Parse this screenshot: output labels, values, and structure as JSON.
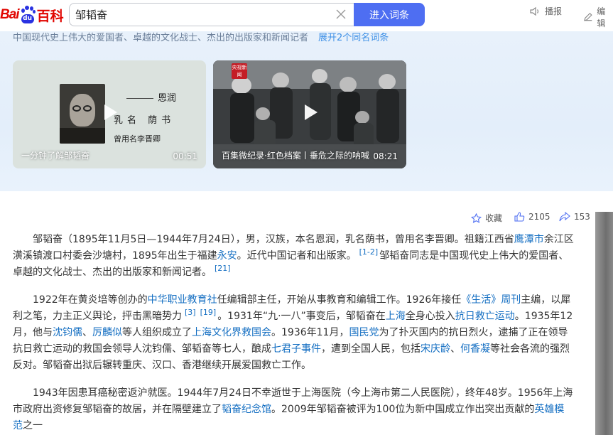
{
  "header": {
    "logo": {
      "bai": "Bai",
      "du": "du",
      "baike": "百科"
    },
    "search_value": "邹韬奋",
    "search_button": "进入词条",
    "broadcast": "播报",
    "edit": "编辑"
  },
  "banner": {
    "summary": "中国现代史上伟大的爱国者、卓越的文化战士、杰出的出版家和新闻记者",
    "more": "展开2个同名词条",
    "videos": [
      {
        "caption": "一分钟了解邹韬奋",
        "duration": "00:51",
        "poster_lines": [
          "恩润",
          "乳名 荫书",
          "曾用名李晋卿"
        ]
      },
      {
        "caption": "百集微纪录·红色档案丨垂危之际的呐喊",
        "duration": "08:21",
        "badge": "央视新闻"
      }
    ]
  },
  "stats": {
    "collect": "收藏",
    "likes": "2105",
    "shares": "153"
  },
  "article": {
    "p1": {
      "t1": "邹韬奋（1895年11月5日—1944年7月24日），男，汉族，本名恩润，乳名荫书，曾用名李晋卿。祖籍江西省",
      "l1": "鹰潭市",
      "t2": "余江区潢溪镇渡口村委会沙塘村，1895年出生于福建",
      "l2": "永安",
      "t3": "。近代中国记者和出版家。",
      "r1": "[1-2]",
      "t4": "邹韬奋同志是中国现代史上伟大的爱国者、卓越的文化战士、杰出的出版家和新闻记者。",
      "r2": "[21]"
    },
    "p2": {
      "t1": "1922年在黄炎培等创办的",
      "l1": "中华职业教育社",
      "t2": "任编辑部主任，开始从事教育和编辑工作。1926年接任",
      "l2": "《生活》周刊",
      "t3": "主编，以犀利之笔，力主正义舆论，抨击黑暗势力",
      "r1": "[3]",
      "r2": "[19]",
      "t4": "。1931年“九·一八”事变后，邹韬奋在",
      "l3": "上海",
      "t5": "全身心投入",
      "l4": "抗日救亡运动",
      "t6": "。1935年12月，他与",
      "l5": "沈钧儒",
      "t7": "、",
      "l6": "厉麟似",
      "t8": "等人组织成立了",
      "l7": "上海文化界救国会",
      "t9": "。1936年11月，",
      "l8": "国民党",
      "t10": "为了扑灭国内的抗日烈火，逮捕了正在领导抗日救亡运动的救国会领导人沈钧儒、邹韬奋等七人，酿成",
      "l9": "七君子事件",
      "t11": "，遭到全国人民，包括",
      "l10": "宋庆龄",
      "t12": "、",
      "l11": "何香凝",
      "t13": "等社会各流的强烈反对。邹韬奋出狱后辗转重庆、汉口、香港继续开展爱国救亡工作。"
    },
    "p3": {
      "t1": "1943年因患耳癌秘密返沪就医。1944年7月24日不幸逝世于上海医院（今上海市第二人民医院），终年48岁。1956年上海市政府出资修复邹韬奋的故居，并在隔壁建立了",
      "l1": "韬奋纪念馆",
      "t2": "。2009年邹韬奋被评为100位为新中国成立作出突出贡献的",
      "l2": "英雄模范",
      "t3": "之一"
    }
  },
  "colors": {
    "link": "#136ec2",
    "search_button": "#4e6ef2",
    "brand_red": "#e10601",
    "brand_blue": "#2932e1"
  }
}
